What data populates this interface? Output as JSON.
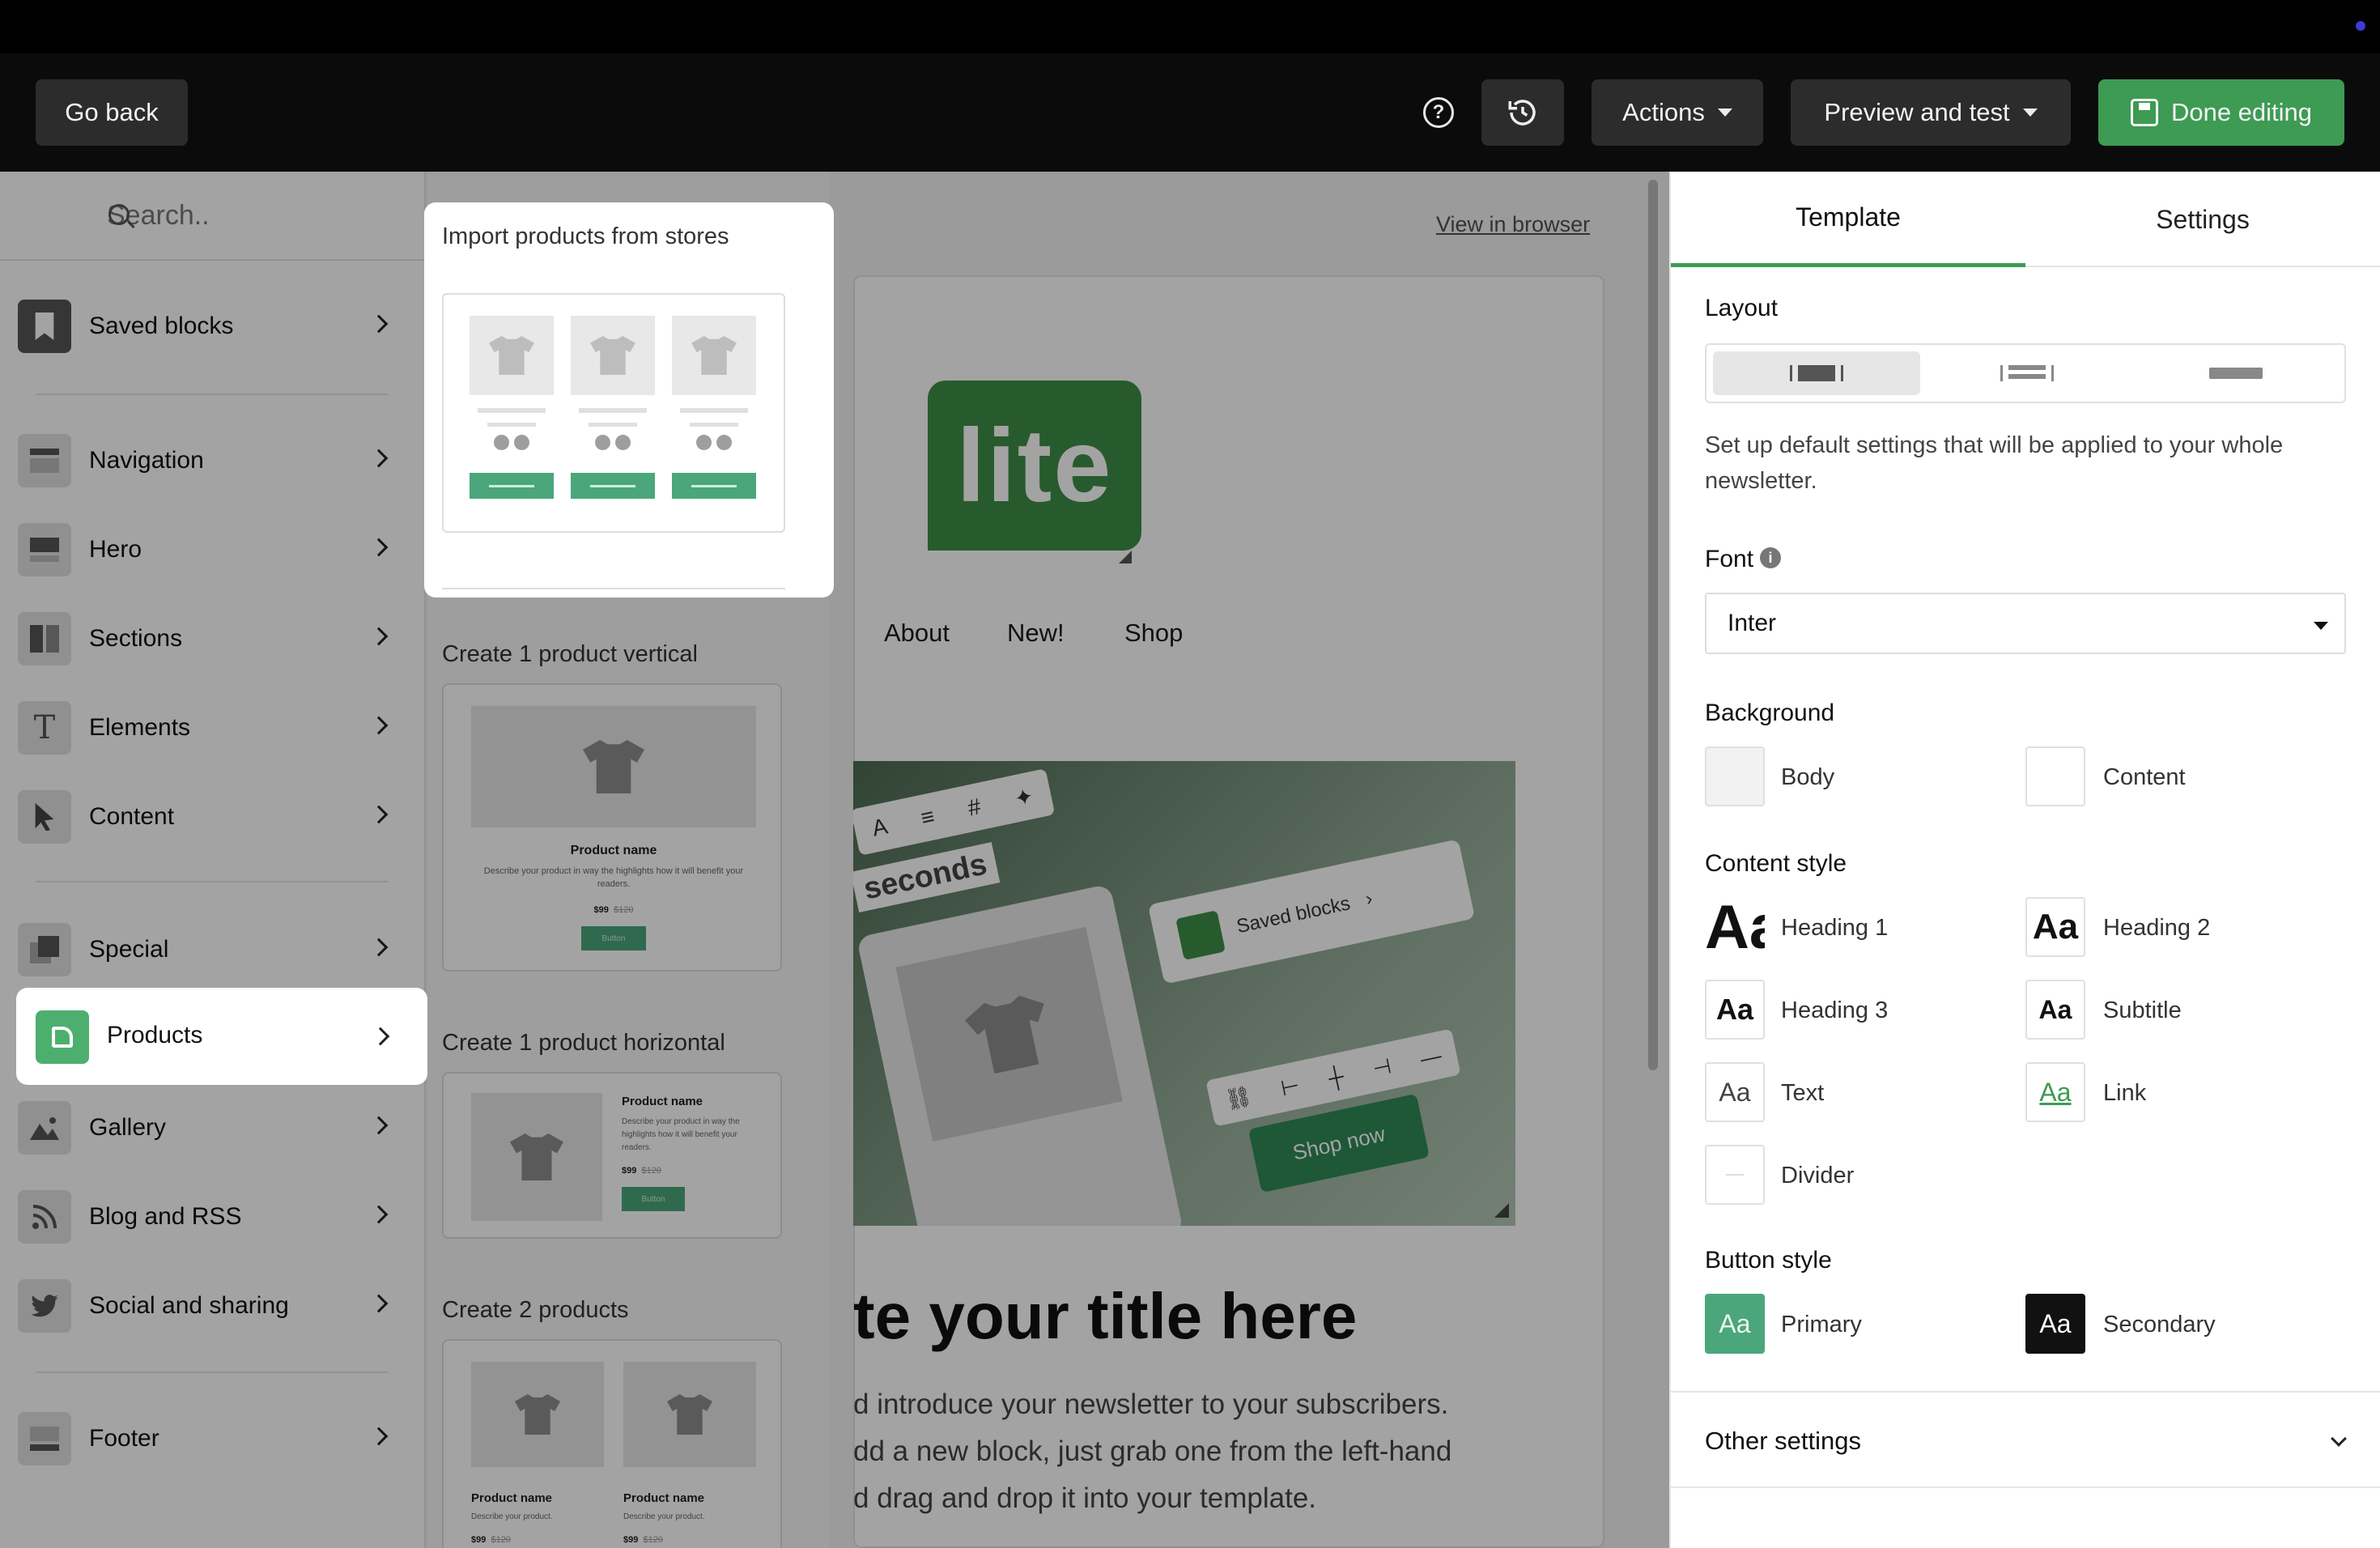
{
  "header": {
    "go_back": "Go back",
    "actions": "Actions",
    "preview": "Preview and test",
    "done": "Done editing",
    "icons": [
      "help-icon",
      "history-icon",
      "save-icon"
    ]
  },
  "sidebar": {
    "search_placeholder": "Search..",
    "items": [
      {
        "label": "Saved blocks",
        "icon": "bookmark-icon"
      },
      {
        "label": "Navigation",
        "icon": "navigation-icon"
      },
      {
        "label": "Hero",
        "icon": "hero-icon"
      },
      {
        "label": "Sections",
        "icon": "sections-icon"
      },
      {
        "label": "Elements",
        "icon": "text-icon"
      },
      {
        "label": "Content",
        "icon": "cursor-icon"
      },
      {
        "label": "Special",
        "icon": "special-icon"
      },
      {
        "label": "Products",
        "icon": "tag-icon"
      },
      {
        "label": "Gallery",
        "icon": "image-icon"
      },
      {
        "label": "Blog and RSS",
        "icon": "rss-icon"
      },
      {
        "label": "Social and sharing",
        "icon": "twitter-icon"
      },
      {
        "label": "Footer",
        "icon": "footer-icon"
      }
    ]
  },
  "blocks": {
    "import_title": "Import products from stores",
    "b1": "Create 1 product vertical",
    "b2": "Create 1 product horizontal",
    "b3": "Create 2 products",
    "product_name": "Product name",
    "product_desc": "Describe your product in way the highlights how it will benefit your readers.",
    "product_desc_short": "Describe your product.",
    "price": "$99",
    "old_price": "$120",
    "button": "Button"
  },
  "canvas": {
    "view_in_browser": "View in browser",
    "logo_text": "lite",
    "nav": [
      "About",
      "New!",
      "Shop"
    ],
    "hero_seconds": "seconds",
    "hero_saved_blocks": "Saved blocks",
    "hero_shop_now": "Shop now",
    "title": "te your title here",
    "body_lines": [
      "d introduce your newsletter to your subscribers.",
      "dd a new block, just grab one from the left-hand",
      "d drag and drop it into your template."
    ]
  },
  "right_panel": {
    "tabs": [
      "Template",
      "Settings"
    ],
    "layout_label": "Layout",
    "description": "Set up default settings that will be applied to your whole newsletter.",
    "font_label": "Font",
    "font_value": "Inter",
    "background_label": "Background",
    "bg_body": "Body",
    "bg_content": "Content",
    "content_style_label": "Content style",
    "styles": {
      "h1": "Heading 1",
      "h2": "Heading 2",
      "h3": "Heading 3",
      "subtitle": "Subtitle",
      "text": "Text",
      "link": "Link",
      "divider": "Divider",
      "swatch_text": "Aa"
    },
    "button_style_label": "Button style",
    "primary": "Primary",
    "secondary": "Secondary",
    "other_settings": "Other settings"
  },
  "colors": {
    "brand_green": "#3d9b53",
    "primary_button": "#4ba67b",
    "secondary_button": "#111111"
  }
}
